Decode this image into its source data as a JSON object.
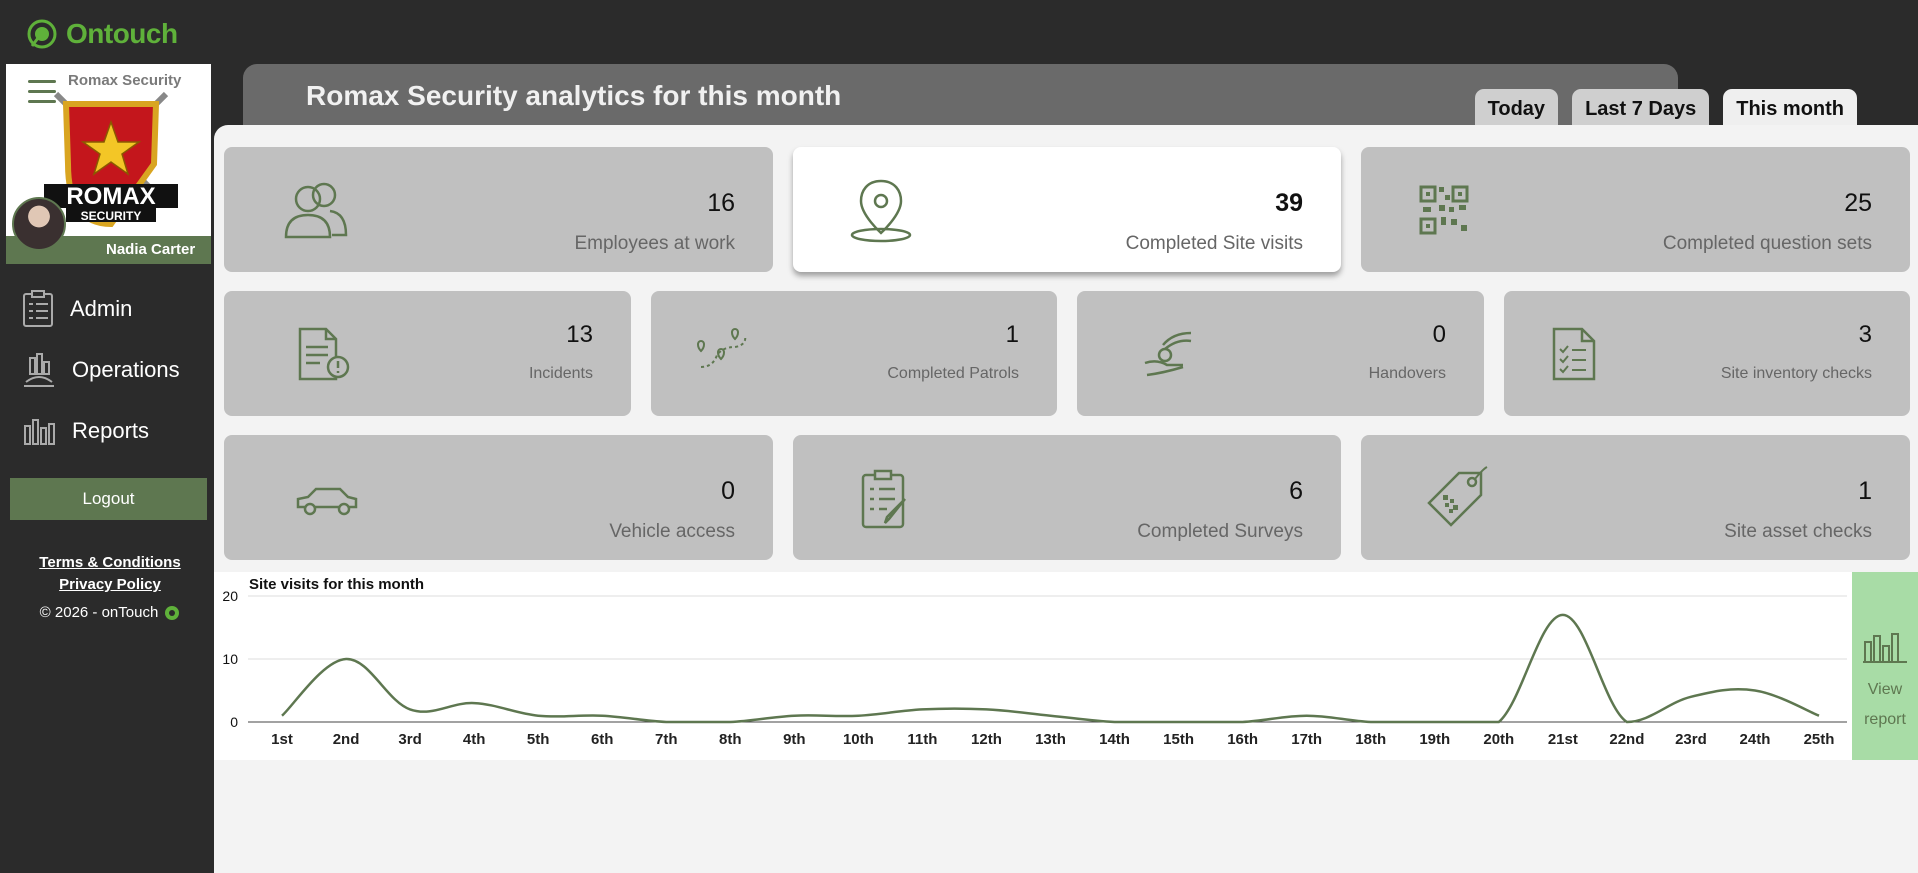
{
  "brand": {
    "name": "Ontouch"
  },
  "profile": {
    "company": "Romax Security",
    "crest_top": "ROMAX",
    "crest_bottom": "SECURITY",
    "user": "Nadia Carter"
  },
  "nav": [
    {
      "label": "Admin",
      "icon": "clipboard-icon"
    },
    {
      "label": "Operations",
      "icon": "operations-icon"
    },
    {
      "label": "Reports",
      "icon": "bar-chart-icon"
    }
  ],
  "logout_label": "Logout",
  "legal": {
    "terms": "Terms & Conditions",
    "privacy": "Privacy Policy",
    "copyright": "© 2026 - onTouch"
  },
  "page_title": "Romax Security analytics for this month",
  "tabs": [
    {
      "label": "Today",
      "active": false
    },
    {
      "label": "Last 7 Days",
      "active": false
    },
    {
      "label": "This month",
      "active": true
    }
  ],
  "cards": {
    "employees": {
      "value": "16",
      "label": "Employees at work",
      "icon": "people-icon"
    },
    "site_visits": {
      "value": "39",
      "label": "Completed Site visits",
      "icon": "map-pin-icon"
    },
    "question_sets": {
      "value": "25",
      "label": "Completed question sets",
      "icon": "qr-code-icon"
    },
    "incidents": {
      "value": "13",
      "label": "Incidents",
      "icon": "incident-report-icon"
    },
    "patrols": {
      "value": "1",
      "label": "Completed Patrols",
      "icon": "route-icon"
    },
    "handovers": {
      "value": "0",
      "label": "Handovers",
      "icon": "handover-icon"
    },
    "inventory": {
      "value": "3",
      "label": "Site inventory checks",
      "icon": "checklist-icon"
    },
    "vehicle": {
      "value": "0",
      "label": "Vehicle access",
      "icon": "car-icon"
    },
    "surveys": {
      "value": "6",
      "label": "Completed Surveys",
      "icon": "survey-icon"
    },
    "assets": {
      "value": "1",
      "label": "Site asset checks",
      "icon": "asset-tag-icon"
    }
  },
  "view_report": {
    "line1": "View",
    "line2": "report",
    "icon": "bar-chart-icon"
  },
  "colors": {
    "accent": "#5e7750",
    "brand": "#5fb13a",
    "card": "#c0c0c0",
    "dark": "#2b2b2b"
  },
  "chart_data": {
    "type": "line",
    "title": "Site visits for this month",
    "categories": [
      "1st",
      "2nd",
      "3rd",
      "4th",
      "5th",
      "6th",
      "7th",
      "8th",
      "9th",
      "10th",
      "11th",
      "12th",
      "13th",
      "14th",
      "15th",
      "16th",
      "17th",
      "18th",
      "19th",
      "20th",
      "21st",
      "22nd",
      "23rd",
      "24th",
      "25th"
    ],
    "values": [
      1,
      10,
      2,
      3,
      1,
      1,
      0,
      0,
      1,
      1,
      2,
      2,
      1,
      0,
      0,
      0,
      1,
      0,
      0,
      0,
      17,
      0,
      4,
      5,
      1
    ],
    "ylim": [
      0,
      20
    ],
    "yticks": [
      0,
      10,
      20
    ],
    "grid": true,
    "xlabel": "",
    "ylabel": ""
  }
}
